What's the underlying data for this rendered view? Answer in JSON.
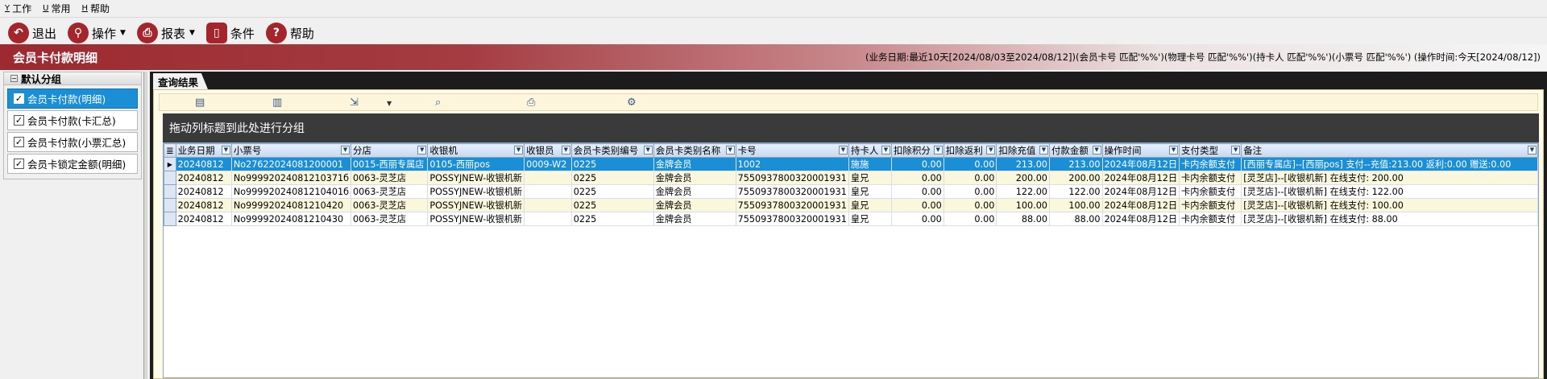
{
  "menubar": {
    "items": [
      {
        "acc": "Y",
        "label": "工作"
      },
      {
        "acc": "U",
        "label": "常用"
      },
      {
        "acc": "H",
        "label": "帮助"
      }
    ]
  },
  "toolbar": {
    "exit_label": "退出",
    "operate_label": "操作",
    "report_label": "报表",
    "condition_label": "条件",
    "help_label": "帮助"
  },
  "page": {
    "title": "会员卡付款明细",
    "filter_info": "(业务日期:最近10天[2024/08/03至2024/08/12])(会员卡号 匹配'%%')(物理卡号 匹配'%%')(持卡人 匹配'%%')(小票号 匹配'%%') (操作时间:今天[2024/08/12])"
  },
  "sidebar": {
    "group_title": "默认分组",
    "items": [
      {
        "label": "会员卡付款(明细)"
      },
      {
        "label": "会员卡付款(卡汇总)"
      },
      {
        "label": "会员卡付款(小票汇总)"
      },
      {
        "label": "会员卡锁定金额(明细)"
      }
    ]
  },
  "results": {
    "tab_label": "查询结果",
    "group_hint": "拖动列标题到此处进行分组"
  },
  "grid": {
    "columns": [
      "业务日期",
      "小票号",
      "分店",
      "收银机",
      "收银员",
      "会员卡类别编号",
      "会员卡类别名称",
      "卡号",
      "持卡人",
      "扣除积分",
      "扣除返利",
      "扣除充值",
      "付款金额",
      "操作时间",
      "支付类型",
      "备注"
    ],
    "rows": [
      [
        "20240812",
        "No27622024081200001",
        "0015-西丽专属店",
        "0105-西丽pos",
        "0009-W2",
        "0225",
        "金牌会员",
        "1002",
        "施施",
        "0.00",
        "0.00",
        "213.00",
        "213.00",
        "2024年08月12日",
        "卡内余额支付",
        "[西丽专属店]--[西丽pos] 支付--充值:213.00 返利:0.00 赠送:0.00"
      ],
      [
        "20240812",
        "No99992024081210371б",
        "0063-灵芝店",
        "POSSYJNEW-收银机新",
        "",
        "0225",
        "金牌会员",
        "7550937800320001931",
        "皇兄",
        "0.00",
        "0.00",
        "200.00",
        "200.00",
        "2024年08月12日",
        "卡内余额支付",
        "[灵芝店]--[收银机新] 在线支付: 200.00"
      ],
      [
        "20240812",
        "No99992024081210401б",
        "0063-灵芝店",
        "POSSYJNEW-收银机新",
        "",
        "0225",
        "金牌会员",
        "7550937800320001931",
        "皇兄",
        "0.00",
        "0.00",
        "122.00",
        "122.00",
        "2024年08月12日",
        "卡内余额支付",
        "[灵芝店]--[收银机新] 在线支付: 122.00"
      ],
      [
        "20240812",
        "No99992024081210420",
        "0063-灵芝店",
        "POSSYJNEW-收银机新",
        "",
        "0225",
        "金牌会员",
        "7550937800320001931",
        "皇兄",
        "0.00",
        "0.00",
        "100.00",
        "100.00",
        "2024年08月12日",
        "卡内余额支付",
        "[灵芝店]--[收银机新] 在线支付: 100.00"
      ],
      [
        "20240812",
        "No99992024081210430",
        "0063-灵芝店",
        "POSSYJNEW-收银机新",
        "",
        "0225",
        "金牌会员",
        "7550937800320001931",
        "皇兄",
        "0.00",
        "0.00",
        "88.00",
        "88.00",
        "2024年08月12日",
        "卡内余额支付",
        "[灵芝店]--[收银机新] 在线支付: 88.00"
      ]
    ]
  },
  "colors": {
    "brand": "#9c2a30",
    "selection": "#1a8fd6",
    "header": "#c6d8ef"
  }
}
